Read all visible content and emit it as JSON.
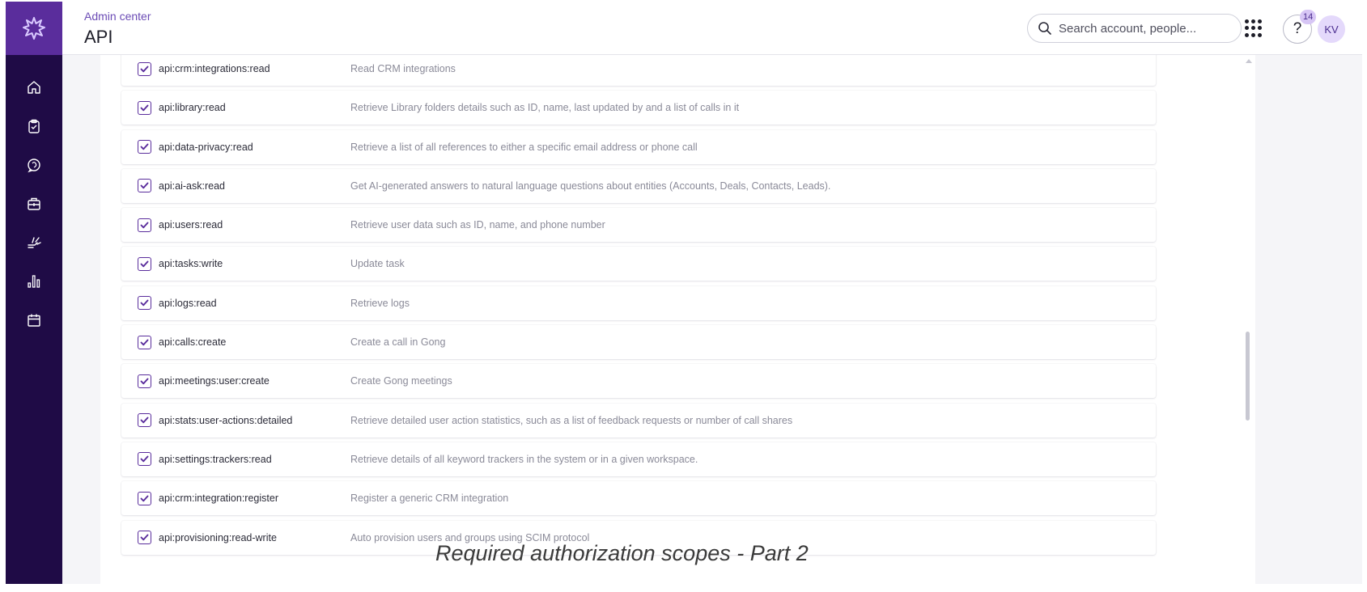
{
  "header": {
    "breadcrumb": "Admin center",
    "title": "API",
    "search_placeholder": "Search account, people...",
    "notification_count": "14",
    "help_symbol": "?",
    "avatar_initials": "KV"
  },
  "sidebar": {
    "icons": [
      "home-icon",
      "clipboard-icon",
      "conversations-icon",
      "deals-icon",
      "engage-icon",
      "analytics-icon",
      "calendar-icon"
    ]
  },
  "scopes": [
    {
      "name": "api:crm:integrations:read",
      "description": "Read CRM integrations",
      "checked": true
    },
    {
      "name": "api:library:read",
      "description": "Retrieve Library folders details such as ID, name, last updated by and a list of calls in it",
      "checked": true
    },
    {
      "name": "api:data-privacy:read",
      "description": "Retrieve a list of all references to either a specific email address or phone call",
      "checked": true
    },
    {
      "name": "api:ai-ask:read",
      "description": "Get AI-generated answers to natural language questions about entities (Accounts, Deals, Contacts, Leads).",
      "checked": true
    },
    {
      "name": "api:users:read",
      "description": "Retrieve user data such as ID, name, and phone number",
      "checked": true
    },
    {
      "name": "api:tasks:write",
      "description": "Update task",
      "checked": true
    },
    {
      "name": "api:logs:read",
      "description": "Retrieve logs",
      "checked": true
    },
    {
      "name": "api:calls:create",
      "description": "Create a call in Gong",
      "checked": true
    },
    {
      "name": "api:meetings:user:create",
      "description": "Create Gong meetings",
      "checked": true
    },
    {
      "name": "api:stats:user-actions:detailed",
      "description": "Retrieve detailed user action statistics, such as a list of feedback requests or number of call shares",
      "checked": true
    },
    {
      "name": "api:settings:trackers:read",
      "description": "Retrieve details of all keyword trackers in the system or in a given workspace.",
      "checked": true
    },
    {
      "name": "api:crm:integration:register",
      "description": "Register a generic CRM integration",
      "checked": true
    },
    {
      "name": "api:provisioning:read-write",
      "description": "Auto provision users and groups using SCIM protocol",
      "checked": true
    }
  ],
  "caption": "Required authorization scopes - Part 2",
  "colors": {
    "sidebar": "#1f0b46",
    "logo_bg": "#5a2d9c",
    "accent": "#6b4bb5"
  }
}
